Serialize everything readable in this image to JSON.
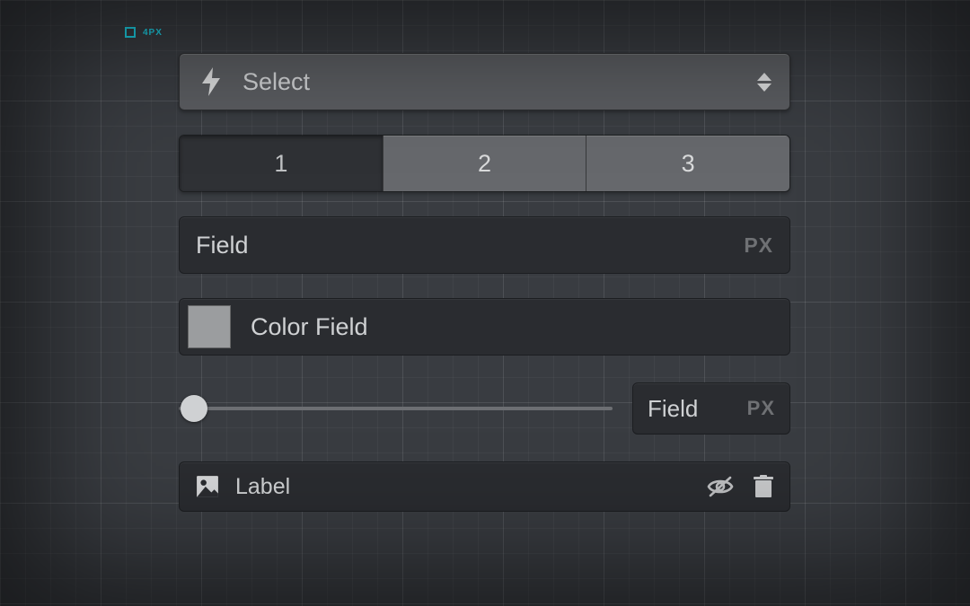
{
  "badge": {
    "label": "4PX"
  },
  "select": {
    "label": "Select",
    "icon": "bolt-icon"
  },
  "segmented": {
    "options": [
      "1",
      "2",
      "3"
    ],
    "selected_index": 0
  },
  "text_field": {
    "label": "Field",
    "unit": "PX"
  },
  "color_field": {
    "label": "Color Field",
    "swatch_color": "#9b9d9f"
  },
  "slider": {
    "small_field_label": "Field",
    "small_field_unit": "PX",
    "value_percent": 0
  },
  "label_row": {
    "icon": "picture-icon",
    "title": "Label",
    "actions": {
      "visibility": "eye-off-icon",
      "delete": "trash-icon"
    }
  }
}
